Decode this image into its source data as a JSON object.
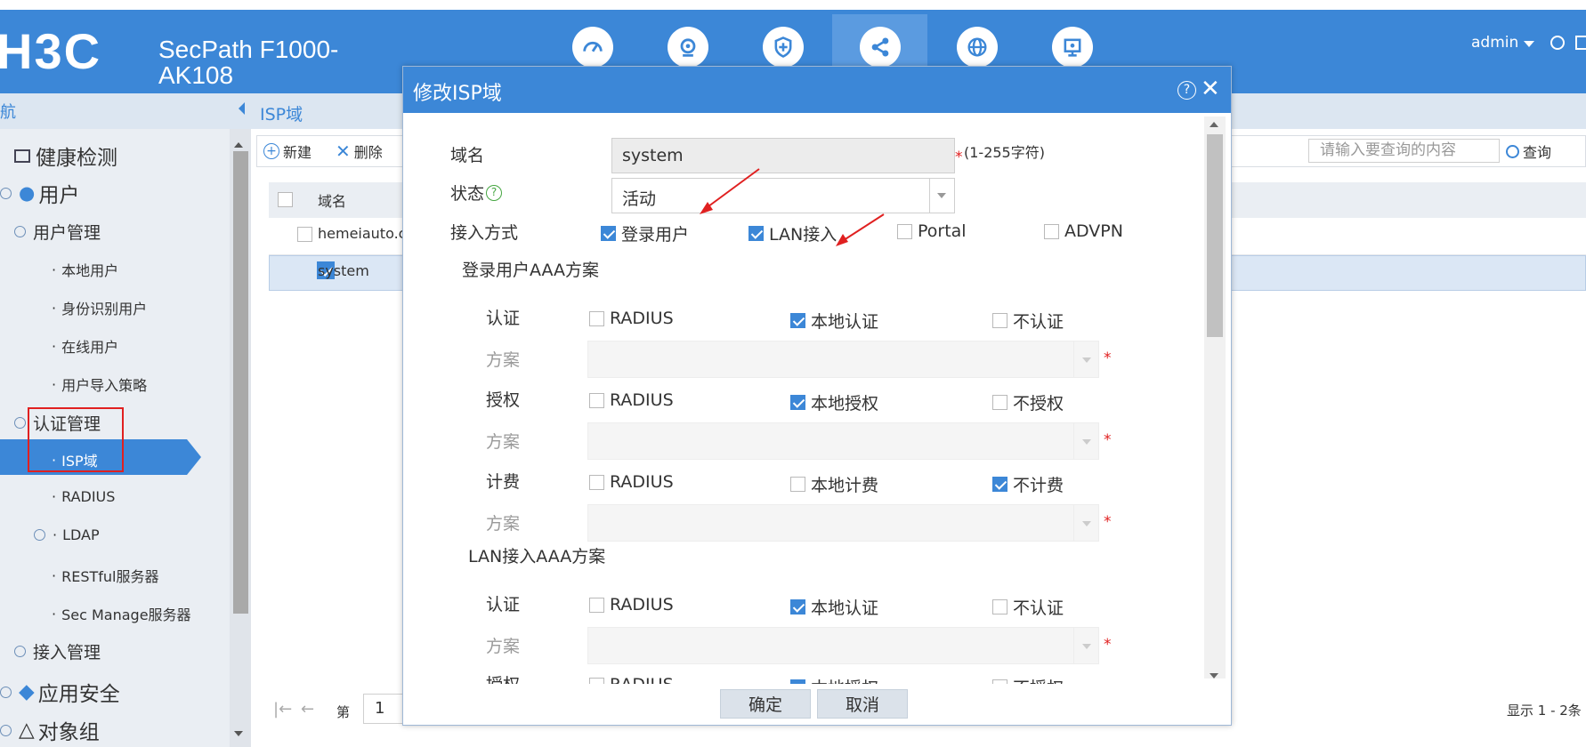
{
  "header": {
    "logo_text": "H3C",
    "product_name": "SecPath F1000-AK108",
    "nav_icons": [
      "dashboard-icon",
      "monitor-icon",
      "shield-icon",
      "network-share-icon",
      "globe-icon",
      "system-icon"
    ],
    "active_nav_index": 3,
    "user": "admin"
  },
  "nav": {
    "title": "航",
    "breadcrumb": "ISP域",
    "items": [
      {
        "label": "健康检测"
      },
      {
        "label": "用户"
      },
      {
        "label": "用户管理"
      },
      {
        "label": "本地用户"
      },
      {
        "label": "身份识别用户"
      },
      {
        "label": "在线用户"
      },
      {
        "label": "用户导入策略"
      },
      {
        "label": "认证管理"
      },
      {
        "label": "ISP域"
      },
      {
        "label": "RADIUS"
      },
      {
        "label": "LDAP"
      },
      {
        "label": "RESTful服务器"
      },
      {
        "label": "Sec Manage服务器"
      },
      {
        "label": "接入管理"
      },
      {
        "label": "应用安全"
      },
      {
        "label": "对象组"
      }
    ]
  },
  "toolbar": {
    "new_label": "新建",
    "delete_label": "删除",
    "search_placeholder": "请输入要查询的内容",
    "query_label": "查询"
  },
  "table": {
    "header_domain": "域名",
    "rows": [
      {
        "domain": "hemeiauto.c",
        "checked": false
      },
      {
        "domain": "system",
        "checked": true
      }
    ]
  },
  "pager": {
    "page_prefix": "第",
    "page_value": "1",
    "summary": "显示 1 - 2条"
  },
  "dialog": {
    "title": "修改ISP域",
    "domain_label": "域名",
    "domain_value": "system",
    "domain_hint": "(1-255字符)",
    "status_label": "状态",
    "status_value": "活动",
    "access_label": "接入方式",
    "access_options": [
      {
        "label": "登录用户",
        "checked": true
      },
      {
        "label": "LAN接入",
        "checked": true
      },
      {
        "label": "Portal",
        "checked": false
      },
      {
        "label": "ADVPN",
        "checked": false
      }
    ],
    "login_section": "登录用户AAA方案",
    "lan_section": "LAN接入AAA方案",
    "auth_label": "认证",
    "author_label": "授权",
    "acct_label": "计费",
    "scheme_label": "方案",
    "radius": "RADIUS",
    "local_auth": "本地认证",
    "no_auth": "不认证",
    "local_author": "本地授权",
    "no_author": "不授权",
    "local_acct": "本地计费",
    "no_acct": "不计费",
    "required_mark": "*",
    "ok_label": "确定",
    "cancel_label": "取消"
  }
}
